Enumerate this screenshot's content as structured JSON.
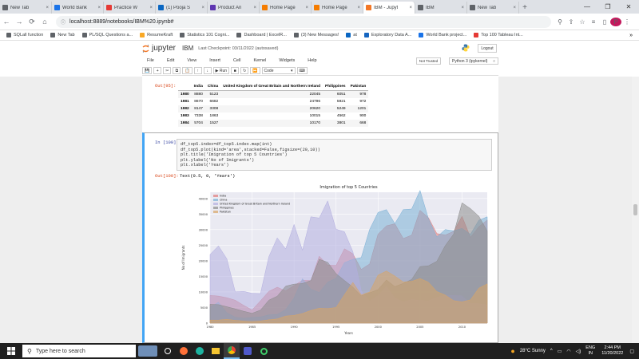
{
  "browser": {
    "tabs": [
      {
        "label": "New Tab",
        "color": "#5f6368",
        "active": false
      },
      {
        "label": "World Bank",
        "color": "#1a73e8",
        "active": false
      },
      {
        "label": "Practice W",
        "color": "#e53935",
        "active": false
      },
      {
        "label": "(1) Pooja S",
        "color": "#0a66c2",
        "active": false
      },
      {
        "label": "Product An",
        "color": "#5e35b1",
        "active": false
      },
      {
        "label": "Home Page",
        "color": "#f57c00",
        "active": false
      },
      {
        "label": "Home Page",
        "color": "#f57c00",
        "active": false
      },
      {
        "label": "IBM - Jupyt",
        "color": "#f37726",
        "active": true
      },
      {
        "label": "IBM",
        "color": "#5f6368",
        "active": false
      },
      {
        "label": "New Tab",
        "color": "#5f6368",
        "active": false
      }
    ],
    "new_tab": "+",
    "url": "localhost:8889/notebooks/IBM%20.ipynb#",
    "bookmarks": [
      {
        "label": "SQLall function",
        "color": "#5f6368"
      },
      {
        "label": "New Tab",
        "color": "#5f6368"
      },
      {
        "label": "PL/SQL Questions a...",
        "color": "#5f6368"
      },
      {
        "label": "ResumeKraft",
        "color": "#f9a825"
      },
      {
        "label": "Statistics 101 Cogni...",
        "color": "#5f6368"
      },
      {
        "label": "Dashboard | ExcelR...",
        "color": "#5f6368"
      },
      {
        "label": "(3) New Messages!",
        "color": "#5f6368"
      },
      {
        "label": "at",
        "color": "#0a66c2"
      },
      {
        "label": "Exploratory Data A...",
        "color": "#1565c0"
      },
      {
        "label": "World Bank project...",
        "color": "#1a73e8"
      },
      {
        "label": "Top 100 Tableau Int...",
        "color": "#e53935"
      }
    ],
    "more_bookmarks": "»"
  },
  "jupyter": {
    "logo_text": "jupyter",
    "notebook_name": "IBM",
    "checkpoint": "Last Checkpoint: 03/11/2022  (autosaved)",
    "logout": "Logout",
    "menu": [
      "File",
      "Edit",
      "View",
      "Insert",
      "Cell",
      "Kernel",
      "Widgets",
      "Help"
    ],
    "trusted": "Not Trusted",
    "kernel": "Python 3 (ipykernel)",
    "toolbar": {
      "run_label": "Run",
      "cell_type": "Code"
    }
  },
  "output_95": {
    "prompt": "Out[95]:",
    "columns": [
      "",
      "India",
      "China",
      "United Kingdom of Great Britain and Northern Ireland",
      "Philippines",
      "Pakistan"
    ],
    "rows": [
      [
        "1980",
        "8880",
        "5123",
        "22045",
        "6051",
        "978"
      ],
      [
        "1981",
        "8670",
        "6682",
        "24796",
        "5921",
        "972"
      ],
      [
        "1982",
        "8147",
        "3308",
        "20620",
        "5249",
        "1201"
      ],
      [
        "1983",
        "7338",
        "1863",
        "10015",
        "4562",
        "900"
      ],
      [
        "1984",
        "5704",
        "1527",
        "10170",
        "3801",
        "668"
      ]
    ]
  },
  "cell_100": {
    "in_prompt": "In [100]:",
    "code": [
      "df_top5.index=df_top5.index.map(int)",
      "df_top5.plot(kind='area',stacked=False,figsize=(20,10))",
      "plt.title('Imigration of top 5 Countries')",
      "plt.ylabel('No of Imigrants')",
      "plt.xlabel('Years')"
    ],
    "out_prompt": "Out[100]:",
    "out_text": "Text(0.5, 0, 'Years')"
  },
  "chart_data": {
    "type": "area",
    "stacked": false,
    "title": "Imigration of top 5 Countries",
    "xlabel": "Years",
    "ylabel": "No of Imigrants",
    "ylim": [
      0,
      42000
    ],
    "xlim": [
      1980,
      2013
    ],
    "yticks": [
      0,
      5000,
      10000,
      15000,
      20000,
      25000,
      30000,
      35000,
      40000
    ],
    "xticks": [
      1980,
      1985,
      1990,
      1995,
      2000,
      2005,
      2010
    ],
    "legend_position": "top-left",
    "grid": true,
    "x": [
      1980,
      1981,
      1982,
      1983,
      1984,
      1985,
      1986,
      1987,
      1988,
      1989,
      1990,
      1991,
      1992,
      1993,
      1994,
      1995,
      1996,
      1997,
      1998,
      1999,
      2000,
      2001,
      2002,
      2003,
      2004,
      2005,
      2006,
      2007,
      2008,
      2009,
      2010,
      2011,
      2012,
      2013
    ],
    "series": [
      {
        "name": "India",
        "color": "#e07b7b",
        "values": [
          8880,
          8670,
          8147,
          7338,
          5704,
          4211,
          7150,
          10189,
          11522,
          10343,
          12041,
          13734,
          13673,
          21496,
          18620,
          18489,
          23859,
          22268,
          17241,
          18974,
          28572,
          31223,
          31889,
          27155,
          28235,
          36210,
          33848,
          28742,
          28261,
          29456,
          34235,
          27509,
          30933,
          33087
        ]
      },
      {
        "name": "China",
        "color": "#7ab0d6",
        "values": [
          5123,
          6682,
          3308,
          1863,
          1527,
          1816,
          1960,
          2643,
          2758,
          4323,
          8076,
          14255,
          10846,
          9817,
          13128,
          14398,
          19415,
          20475,
          21049,
          30069,
          35529,
          36434,
          31961,
          36439,
          36619,
          42584,
          33518,
          27642,
          30037,
          29622,
          30391,
          28502,
          33024,
          34129
        ]
      },
      {
        "name": "United Kingdom of Great Britain and Northern Ireland",
        "color": "#b3aee0",
        "values": [
          22045,
          24796,
          20620,
          10015,
          10170,
          9564,
          9470,
          21337,
          27359,
          23795,
          31668,
          23380,
          34123,
          33720,
          39231,
          30145,
          29322,
          22965,
          10367,
          7045,
          8840,
          11728,
          8046,
          6797,
          7533,
          7258,
          7140,
          8216,
          8979,
          8876,
          8724,
          6204,
          6195,
          5827
        ]
      },
      {
        "name": "Philippines",
        "color": "#8c8c8c",
        "values": [
          6051,
          5921,
          5249,
          4562,
          3801,
          3150,
          4166,
          7360,
          8639,
          11865,
          12509,
          12718,
          13670,
          20479,
          19532,
          15864,
          13692,
          11549,
          8735,
          9734,
          10763,
          13836,
          11707,
          12758,
          14004,
          18139,
          18400,
          19837,
          24887,
          28573,
          38617,
          36765,
          34315,
          29544
        ]
      },
      {
        "name": "Pakistan",
        "color": "#d9a566",
        "values": [
          978,
          972,
          1201,
          900,
          668,
          514,
          691,
          1072,
          1334,
          2261,
          2470,
          3079,
          4071,
          4777,
          4666,
          4994,
          9125,
          13073,
          9068,
          9979,
          15400,
          16708,
          15110,
          13205,
          13399,
          14314,
          13127,
          10124,
          8994,
          7217,
          6811,
          7468,
          11227,
          12603
        ]
      }
    ]
  },
  "taskbar": {
    "search_placeholder": "Type here to search",
    "weather": "28°C  Sunny",
    "lang_top": "ENG",
    "lang_bottom": "IN",
    "time": "2:44 PM",
    "date": "11/20/2022"
  }
}
